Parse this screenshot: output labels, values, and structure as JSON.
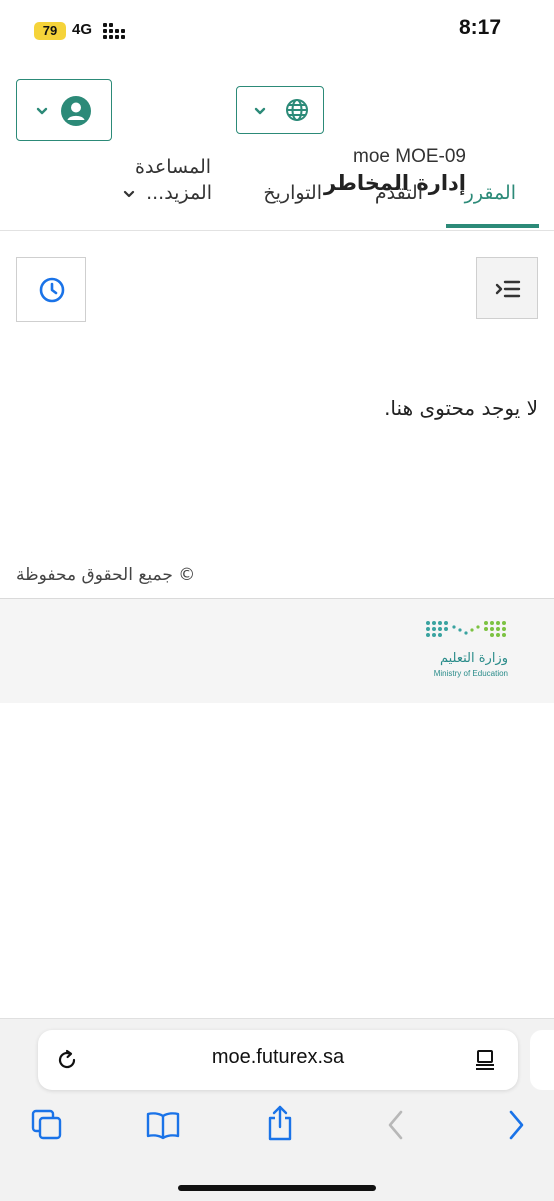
{
  "status_bar": {
    "battery": "79",
    "network": "4G",
    "time": "8:17"
  },
  "header": {
    "course_code": "moe MOE-09",
    "course_name": "إدارة المخاطر",
    "help_label": "المساعدة"
  },
  "tabs": [
    {
      "label": "المقرر",
      "active": true
    },
    {
      "label": "التقدم",
      "active": false
    },
    {
      "label": "التواريخ",
      "active": false
    },
    {
      "label": "المزيد...",
      "active": false
    }
  ],
  "main": {
    "empty_message": "لا يوجد محتوى هنا.",
    "copyright": "© جميع الحقوق محفوظة"
  },
  "footer": {
    "logo_arabic": "وزارة التعليم",
    "logo_english": "Ministry of Education"
  },
  "browser": {
    "url": "moe.futurex.sa"
  },
  "colors": {
    "accent": "#2c8a78",
    "link_blue": "#1a73e8"
  }
}
